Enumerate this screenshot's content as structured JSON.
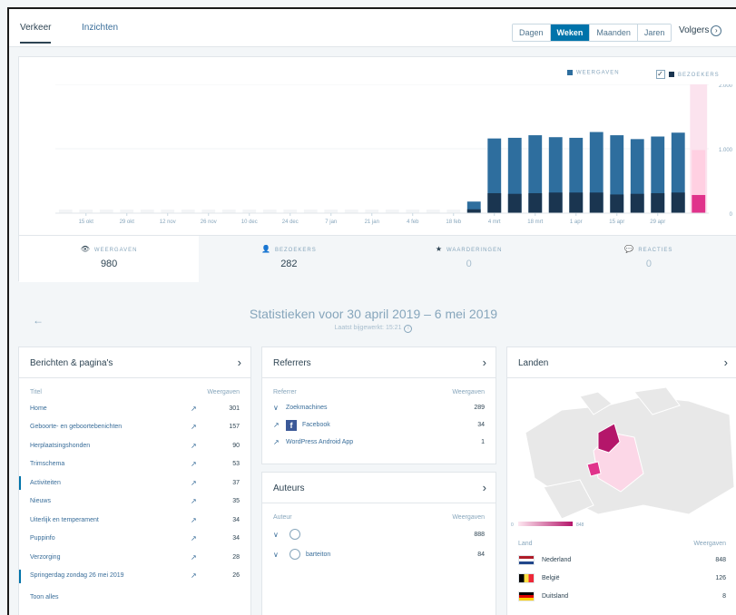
{
  "nav": {
    "tabs": [
      "Verkeer",
      "Inzichten"
    ],
    "periods": [
      "Dagen",
      "Weken",
      "Maanden",
      "Jaren"
    ],
    "active_period": "Weken",
    "follow_label": "Volgers",
    "follow_icon_glyph": "›"
  },
  "chart": {
    "legend_views": "WEERGAVEN",
    "legend_visitors": "BEZOEKERS",
    "check_glyph": "✓",
    "colors": {
      "views": "#2e6e9e",
      "visitors": "#1a3550",
      "highlight_views": "#ffd0e2",
      "highlight_visitors": "#e0338b",
      "highlight_bg": "#fbe3ee"
    }
  },
  "chart_data": {
    "type": "bar",
    "categories": [
      "15 okt",
      "29 okt",
      "12 nov",
      "26 nov",
      "10 dec",
      "24 dec",
      "7 jan",
      "21 jan",
      "4 feb",
      "18 feb",
      "4 mrt",
      "18 mrt",
      "1 apr",
      "15 apr",
      "29 apr"
    ],
    "weeks": 29,
    "series": [
      {
        "name": "Weergaven",
        "values": [
          0,
          0,
          0,
          0,
          0,
          0,
          0,
          0,
          0,
          0,
          0,
          0,
          0,
          0,
          0,
          0,
          0,
          0,
          0,
          0,
          180,
          1160,
          1170,
          1210,
          1180,
          1170,
          1260,
          1210,
          1150,
          1190,
          1250,
          980
        ]
      },
      {
        "name": "Bezoekers",
        "values": [
          0,
          0,
          0,
          0,
          0,
          0,
          0,
          0,
          0,
          0,
          0,
          0,
          0,
          0,
          0,
          0,
          0,
          0,
          0,
          0,
          60,
          310,
          300,
          310,
          320,
          320,
          320,
          290,
          300,
          310,
          320,
          282
        ]
      }
    ],
    "y_ticks": [
      "2.000",
      "1.000",
      "0"
    ],
    "ylim": [
      0,
      2000
    ],
    "highlight_last": true
  },
  "stats": [
    {
      "icon": "eye-icon",
      "glyph": "👁",
      "label": "WEERGAVEN",
      "value": "980"
    },
    {
      "icon": "person-icon",
      "glyph": "👤",
      "label": "BEZOEKERS",
      "value": "282"
    },
    {
      "icon": "star-icon",
      "glyph": "★",
      "label": "WAARDERINGEN",
      "value": "0"
    },
    {
      "icon": "comment-icon",
      "glyph": "💬",
      "label": "REACTIES",
      "value": "0"
    }
  ],
  "period": {
    "back_glyph": "←",
    "title": "Statistieken voor 30 april 2019 – 6 mei 2019",
    "updated": "Laatst bijgewerkt: 15:21",
    "info_glyph": "i"
  },
  "posts": {
    "title": "Berichten & pagina's",
    "chevron": "›",
    "col_title": "Titel",
    "col_views": "Weergaven",
    "ext_glyph": "↗",
    "rows": [
      {
        "name": "Home",
        "views": "301",
        "marked": false
      },
      {
        "name": "Geboorte- en geboortebenichten",
        "views": "157",
        "marked": false
      },
      {
        "name": "Herplaatsingshonden",
        "views": "90",
        "marked": false
      },
      {
        "name": "Trimschema",
        "views": "53",
        "marked": false
      },
      {
        "name": "Activiteiten",
        "views": "37",
        "marked": true
      },
      {
        "name": "Nieuws",
        "views": "35",
        "marked": false
      },
      {
        "name": "Uiterlijk en temperament",
        "views": "34",
        "marked": false
      },
      {
        "name": "Puppinfo",
        "views": "34",
        "marked": false
      },
      {
        "name": "Verzorging",
        "views": "28",
        "marked": false
      },
      {
        "name": "Springerdag zondag 26 mei 2019",
        "views": "26",
        "marked": true
      }
    ],
    "show_all": "Toon alles"
  },
  "referrers": {
    "title": "Referrers",
    "chevron": "›",
    "col_title": "Referrer",
    "col_views": "Weergaven",
    "rows": [
      {
        "icon": "chevron-down-icon",
        "glyph": "∨",
        "name": "Zoekmachines",
        "views": "289",
        "fb": false
      },
      {
        "icon": "external-link-icon",
        "glyph": "↗",
        "name": "Facebook",
        "views": "34",
        "fb": true
      },
      {
        "icon": "external-link-icon",
        "glyph": "↗",
        "name": "WordPress Android App",
        "views": "1",
        "fb": false
      }
    ],
    "fb_glyph": "f"
  },
  "authors": {
    "title": "Auteurs",
    "chevron": "›",
    "col_title": "Auteur",
    "col_views": "Weergaven",
    "rows": [
      {
        "name": "",
        "views": "888"
      },
      {
        "name": "barteiton",
        "views": "84"
      }
    ],
    "expand_glyph": "∨"
  },
  "countries": {
    "title": "Landen",
    "chevron": "›",
    "scale_min": "0",
    "scale_max": "848",
    "col_title": "Land",
    "col_views": "Weergaven",
    "rows": [
      {
        "flag": "flag-nl",
        "name": "Nederland",
        "views": "848"
      },
      {
        "flag": "flag-be",
        "name": "België",
        "views": "126"
      },
      {
        "flag": "flag-de",
        "name": "Duitsland",
        "views": "8"
      }
    ]
  }
}
